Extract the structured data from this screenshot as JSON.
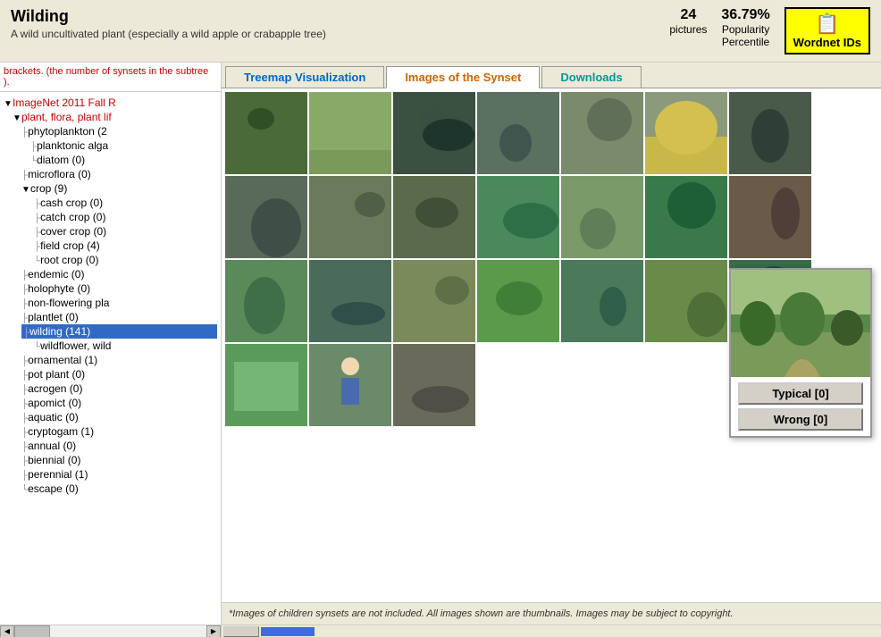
{
  "header": {
    "title": "Wilding",
    "subtitle": "A wild uncultivated plant (especially a wild apple or crabapple tree)",
    "stats": {
      "count": "24",
      "count_label": "pictures",
      "popularity": "36.79%",
      "popularity_label": "Popularity",
      "percentile_label": "Percentile"
    },
    "wordnet_button": "Wordnet IDs",
    "wordnet_icon": "📋"
  },
  "tabs": [
    {
      "label": "Treemap Visualization",
      "color": "blue",
      "active": false
    },
    {
      "label": "Images of the Synset",
      "color": "orange",
      "active": true
    },
    {
      "label": "Downloads",
      "color": "cyan",
      "active": false
    }
  ],
  "sidebar": {
    "pre_text": "brackets. (the number of synsets in the subtree ).",
    "items": [
      {
        "label": "ImageNet 2011 Fall R",
        "indent": 0,
        "expand": true,
        "type": "red"
      },
      {
        "label": "plant, flora, plant lif",
        "indent": 1,
        "expand": true,
        "type": "red"
      },
      {
        "label": "phytoplankton (2",
        "indent": 2,
        "expand": false,
        "type": "normal"
      },
      {
        "label": "planktonic alga",
        "indent": 3,
        "expand": false,
        "type": "normal"
      },
      {
        "label": "diatom (0)",
        "indent": 3,
        "expand": false,
        "type": "normal"
      },
      {
        "label": "microflora (0)",
        "indent": 2,
        "expand": false,
        "type": "normal"
      },
      {
        "label": "crop (9)",
        "indent": 2,
        "expand": true,
        "type": "normal"
      },
      {
        "label": "cash crop (0)",
        "indent": 3,
        "expand": false,
        "type": "normal"
      },
      {
        "label": "catch crop (0)",
        "indent": 3,
        "expand": false,
        "type": "normal"
      },
      {
        "label": "cover crop (0)",
        "indent": 3,
        "expand": false,
        "type": "normal"
      },
      {
        "label": "field crop (4)",
        "indent": 3,
        "expand": false,
        "type": "normal"
      },
      {
        "label": "root crop (0)",
        "indent": 3,
        "expand": false,
        "type": "normal"
      },
      {
        "label": "endemic (0)",
        "indent": 2,
        "expand": false,
        "type": "normal"
      },
      {
        "label": "holophyte (0)",
        "indent": 2,
        "expand": false,
        "type": "normal"
      },
      {
        "label": "non-flowering pla",
        "indent": 2,
        "expand": false,
        "type": "normal"
      },
      {
        "label": "plantlet (0)",
        "indent": 2,
        "expand": false,
        "type": "normal"
      },
      {
        "label": "wilding (141)",
        "indent": 2,
        "expand": false,
        "type": "selected"
      },
      {
        "label": "wildflower, wild",
        "indent": 3,
        "expand": false,
        "type": "normal"
      },
      {
        "label": "ornamental (1)",
        "indent": 2,
        "expand": false,
        "type": "normal"
      },
      {
        "label": "pot plant (0)",
        "indent": 2,
        "expand": false,
        "type": "normal"
      },
      {
        "label": "acrogen (0)",
        "indent": 2,
        "expand": false,
        "type": "normal"
      },
      {
        "label": "apomict (0)",
        "indent": 2,
        "expand": false,
        "type": "normal"
      },
      {
        "label": "aquatic (0)",
        "indent": 2,
        "expand": false,
        "type": "normal"
      },
      {
        "label": "cryptogam (1)",
        "indent": 2,
        "expand": false,
        "type": "normal"
      },
      {
        "label": "annual (0)",
        "indent": 2,
        "expand": false,
        "type": "normal"
      },
      {
        "label": "biennial (0)",
        "indent": 2,
        "expand": false,
        "type": "normal"
      },
      {
        "label": "perennial (1)",
        "indent": 2,
        "expand": false,
        "type": "normal"
      },
      {
        "label": "escape (0)",
        "indent": 2,
        "expand": false,
        "type": "normal"
      }
    ]
  },
  "images": {
    "count": 24,
    "colors": [
      "#4a6a3a",
      "#5a7a4a",
      "#3a5a2a",
      "#6a8a5a",
      "#7a9a6a",
      "#4a7a5a",
      "#5a6a3a",
      "#3a6a4a",
      "#6a7a5a",
      "#4a5a3a",
      "#7a8a6a",
      "#5a8a5a",
      "#3a7a4a",
      "#6a9a5a",
      "#4a8a4a",
      "#5a7a3a",
      "#7a6a5a",
      "#4a9a5a",
      "#6a5a4a",
      "#5a9a4a",
      "#3a8a5a",
      "#7a5a4a",
      "#6a8a4a",
      "#4a6a5a"
    ]
  },
  "tooltip": {
    "typical_btn": "Typical [0]",
    "wrong_btn": "Wrong [0]"
  },
  "footer": {
    "text": "*Images of children synsets are not included. All images shown are thumbnails. Images may be subject to copyright."
  }
}
